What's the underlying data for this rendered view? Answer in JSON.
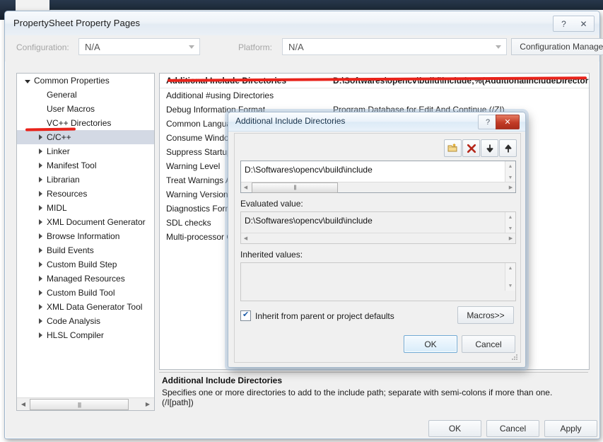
{
  "window": {
    "title": "PropertySheet Property Pages",
    "help_icon": "?",
    "close_icon": "✕"
  },
  "config_bar": {
    "configuration_label": "Configuration:",
    "configuration_value": "N/A",
    "platform_label": "Platform:",
    "platform_value": "N/A",
    "configuration_manager_label": "Configuration Manager..."
  },
  "tree": {
    "items": [
      {
        "label": "Common Properties",
        "indent": 0,
        "twisty": "open",
        "selected": false
      },
      {
        "label": "General",
        "indent": 1,
        "twisty": "none",
        "selected": false
      },
      {
        "label": "User Macros",
        "indent": 1,
        "twisty": "none",
        "selected": false
      },
      {
        "label": "VC++ Directories",
        "indent": 1,
        "twisty": "none",
        "selected": false
      },
      {
        "label": "C/C++",
        "indent": 1,
        "twisty": "closed",
        "selected": true
      },
      {
        "label": "Linker",
        "indent": 1,
        "twisty": "closed",
        "selected": false
      },
      {
        "label": "Manifest Tool",
        "indent": 1,
        "twisty": "closed",
        "selected": false
      },
      {
        "label": "Librarian",
        "indent": 1,
        "twisty": "closed",
        "selected": false
      },
      {
        "label": "Resources",
        "indent": 1,
        "twisty": "closed",
        "selected": false
      },
      {
        "label": "MIDL",
        "indent": 1,
        "twisty": "closed",
        "selected": false
      },
      {
        "label": "XML Document Generator",
        "indent": 1,
        "twisty": "closed",
        "selected": false
      },
      {
        "label": "Browse Information",
        "indent": 1,
        "twisty": "closed",
        "selected": false
      },
      {
        "label": "Build Events",
        "indent": 1,
        "twisty": "closed",
        "selected": false
      },
      {
        "label": "Custom Build Step",
        "indent": 1,
        "twisty": "closed",
        "selected": false
      },
      {
        "label": "Managed Resources",
        "indent": 1,
        "twisty": "closed",
        "selected": false
      },
      {
        "label": "Custom Build Tool",
        "indent": 1,
        "twisty": "closed",
        "selected": false
      },
      {
        "label": "XML Data Generator Tool",
        "indent": 1,
        "twisty": "closed",
        "selected": false
      },
      {
        "label": "Code Analysis",
        "indent": 1,
        "twisty": "closed",
        "selected": false
      },
      {
        "label": "HLSL Compiler",
        "indent": 1,
        "twisty": "closed",
        "selected": false
      }
    ],
    "scroll_left_icon": "◀",
    "scroll_right_icon": "▶",
    "scroll_grip": "||||"
  },
  "grid": {
    "rows": [
      {
        "name": "Additional Include Directories",
        "value": "D:\\Softwares\\opencv\\build\\include;%(AdditionalIncludeDirectories)"
      },
      {
        "name": "Additional #using Directories",
        "value": ""
      },
      {
        "name": "Debug Information Format",
        "value": "Program Database for Edit And Continue (/ZI)"
      },
      {
        "name": "Common Language RunTime Support",
        "value": ""
      },
      {
        "name": "Consume Windows Runtime Extension",
        "value": ""
      },
      {
        "name": "Suppress Startup Banner",
        "value": ""
      },
      {
        "name": "Warning Level",
        "value": ""
      },
      {
        "name": "Treat Warnings As Errors",
        "value": ""
      },
      {
        "name": "Warning Version",
        "value": ""
      },
      {
        "name": "Diagnostics Format",
        "value": ""
      },
      {
        "name": "SDL checks",
        "value": ""
      },
      {
        "name": "Multi-processor Compilation",
        "value": ""
      }
    ]
  },
  "description": {
    "title": "Additional Include Directories",
    "body": "Specifies one or more directories to add to the include path; separate with semi-colons if more than one. (/I[path])"
  },
  "footer": {
    "ok": "OK",
    "cancel": "Cancel",
    "apply": "Apply"
  },
  "dialog": {
    "title": "Additional Include Directories",
    "help_icon": "?",
    "close_icon": "✕",
    "toolbar": {
      "new_line_title": "New Line",
      "delete_title": "Delete",
      "move_down_title": "Move Down",
      "move_up_title": "Move Up"
    },
    "entries_value": "D:\\Softwares\\opencv\\build\\include",
    "evaluated_label": "Evaluated value:",
    "evaluated_value": "D:\\Softwares\\opencv\\build\\include",
    "inherited_label": "Inherited values:",
    "inherited_value": "",
    "inherit_checkbox_label": "Inherit from parent or project defaults",
    "inherit_checked_mark": "✔",
    "macros_label": "Macros>>",
    "ok": "OK",
    "cancel": "Cancel",
    "scroll_up_icon": "▲",
    "scroll_down_icon": "▼",
    "scroll_left_icon": "◀",
    "scroll_right_icon": "▶",
    "scroll_grip": "||||"
  },
  "annotations": {
    "accent_color": "#e8231b"
  }
}
